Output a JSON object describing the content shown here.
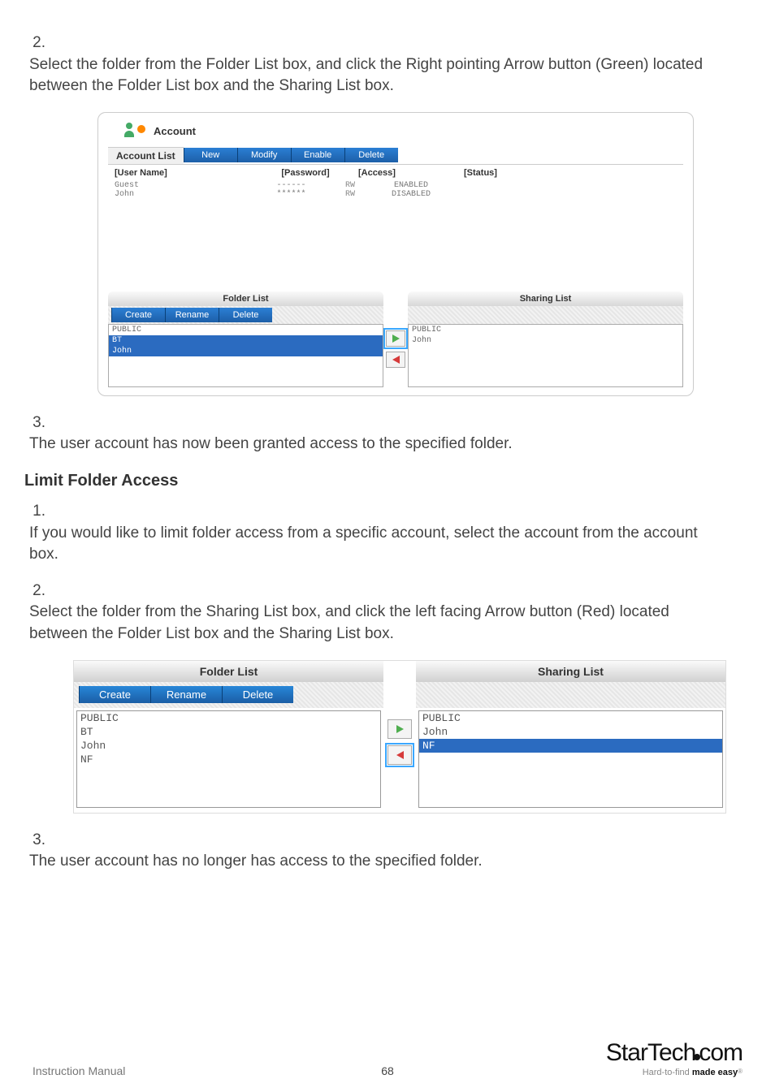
{
  "step2": {
    "num": "2.",
    "text": "Select the folder from the Folder List box, and click the Right pointing Arrow button (Green) located between the Folder List box and the Sharing List box."
  },
  "screenshot1": {
    "title": "Account",
    "accountListLabel": "Account List",
    "buttons": {
      "new": "New",
      "modify": "Modify",
      "enable": "Enable",
      "delete": "Delete"
    },
    "cols": {
      "user": "[User Name]",
      "pw": "[Password]",
      "access": "[Access]",
      "status": "[Status]"
    },
    "rows": [
      {
        "user": "Guest",
        "pw": "------",
        "rw": "RW",
        "access": "ENABLED"
      },
      {
        "user": "John",
        "pw": "******",
        "rw": "RW",
        "access": "DISABLED"
      }
    ],
    "folderListLabel": "Folder List",
    "sharingListLabel": "Sharing List",
    "folderButtons": {
      "create": "Create",
      "rename": "Rename",
      "delete": "Delete"
    },
    "folderItems": [
      "PUBLIC",
      "BT",
      "John"
    ],
    "sharingItems": [
      "PUBLIC",
      "John"
    ]
  },
  "step3": {
    "num": "3.",
    "text": "The user account has now been granted access to the specified folder."
  },
  "limitHeading": "Limit Folder Access",
  "limStep1": {
    "num": "1.",
    "text": "If you would like to limit folder access from a specific account, select the account from the account box."
  },
  "limStep2": {
    "num": "2.",
    "text": "Select the folder from the Sharing List box, and click the left facing Arrow button (Red) located between the Folder List box and the Sharing List box."
  },
  "screenshot2": {
    "folderListLabel": "Folder List",
    "sharingListLabel": "Sharing List",
    "buttons": {
      "create": "Create",
      "rename": "Rename",
      "delete": "Delete"
    },
    "folderItems": [
      "PUBLIC",
      "BT",
      "John",
      "NF"
    ],
    "sharingItems": [
      "PUBLIC",
      "John",
      "NF"
    ]
  },
  "limStep3": {
    "num": "3.",
    "text": "The user account has no longer has access to the specified folder."
  },
  "footer": {
    "left": "Instruction Manual",
    "page": "68",
    "brand": "StarTech",
    "brandSuffix": "com",
    "tagline1": "Hard-to-find ",
    "tagline2": "made easy",
    "reg": "®"
  }
}
